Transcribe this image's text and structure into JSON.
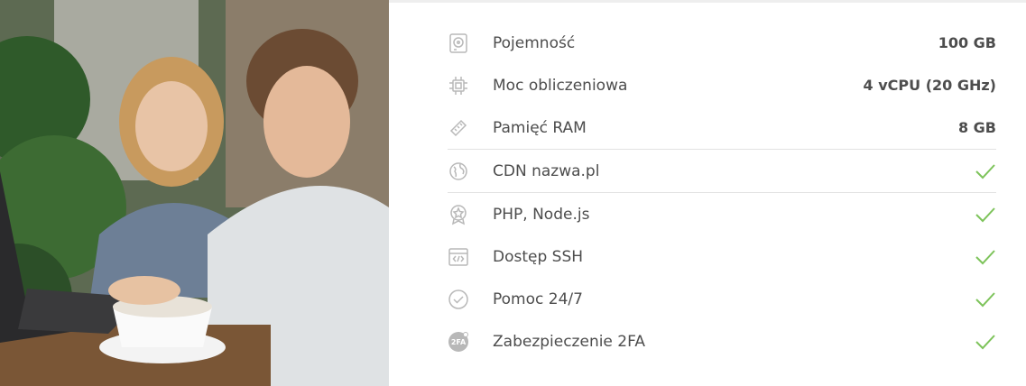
{
  "photo": {
    "alt": "photo-people-laptop"
  },
  "features": [
    {
      "icon": "hard-drive-icon",
      "label": "Pojemność",
      "value": "100 GB",
      "type": "text"
    },
    {
      "icon": "cpu-icon",
      "label": "Moc obliczeniowa",
      "value": "4 vCPU (20 GHz)",
      "type": "text"
    },
    {
      "icon": "ram-icon",
      "label": "Pamięć RAM",
      "value": "8 GB",
      "type": "text"
    },
    {
      "icon": "globe-icon",
      "label": "CDN nazwa.pl",
      "value": "",
      "type": "check"
    },
    {
      "icon": "badge-icon",
      "label": "PHP, Node.js",
      "value": "",
      "type": "check"
    },
    {
      "icon": "code-window-icon",
      "label": "Dostęp SSH",
      "value": "",
      "type": "check"
    },
    {
      "icon": "check-circle-icon",
      "label": "Pomoc 24/7",
      "value": "",
      "type": "check"
    },
    {
      "icon": "2fa-icon",
      "label": "Zabezpieczenie 2FA",
      "value": "",
      "type": "check",
      "icon_text": "2FA"
    }
  ],
  "colors": {
    "check": "#7dc35a",
    "icon": "#b8b8b8",
    "text": "#4d4d4d"
  }
}
